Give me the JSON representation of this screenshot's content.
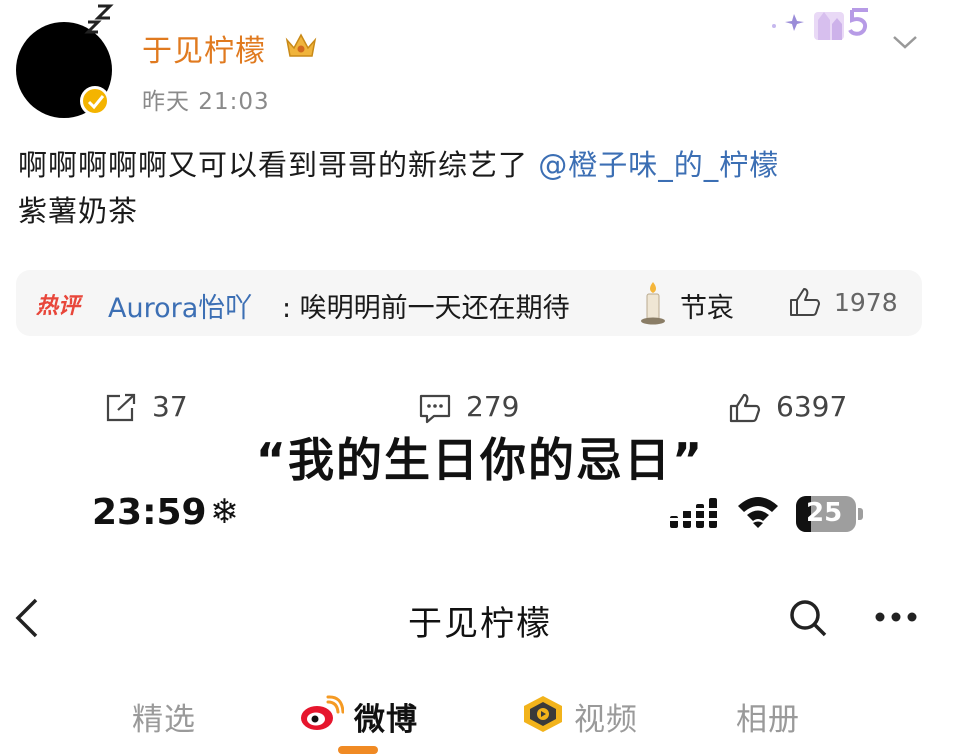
{
  "post": {
    "username": "于见柠檬",
    "timestamp": "昨天 21:03",
    "text_main": "啊啊啊啊啊又可以看到哥哥的新综艺了 ",
    "mention": "@橙子味_的_柠檬",
    "text_tail": "紫薯奶茶",
    "hot_comment": {
      "tag": "热评",
      "author": "Aurora怡吖",
      "body": ": 唉明明前一天还在期待",
      "suffix": "节哀",
      "likes": "1978"
    },
    "actions": {
      "repost_count": "37",
      "comment_count": "279",
      "like_count": "6397"
    }
  },
  "headline": "“我的生日你的忌日”",
  "status_bar": {
    "time": "23:59",
    "extra_glyph": "❄",
    "battery_level": "25"
  },
  "profile_nav": {
    "title": "于见柠檬"
  },
  "tabs": [
    {
      "label": "精选",
      "active": false
    },
    {
      "label": "微博",
      "active": true
    },
    {
      "label": "视频",
      "active": false
    },
    {
      "label": "相册",
      "active": false
    }
  ],
  "colors": {
    "username": "#e07a1f",
    "link": "#3c6fb4",
    "hot_tag": "#e8463a",
    "tab_underline": "#f08a24"
  },
  "icons": [
    "sleep-zzz-icon",
    "verified-badge-icon",
    "crown-icon",
    "chevron-down-icon",
    "candle-icon",
    "thumbs-up-icon",
    "repost-icon",
    "comment-icon",
    "signal-icon",
    "wifi-icon",
    "battery-icon",
    "back-arrow-icon",
    "search-icon",
    "more-icon",
    "weibo-logo-icon",
    "video-badge-icon"
  ]
}
